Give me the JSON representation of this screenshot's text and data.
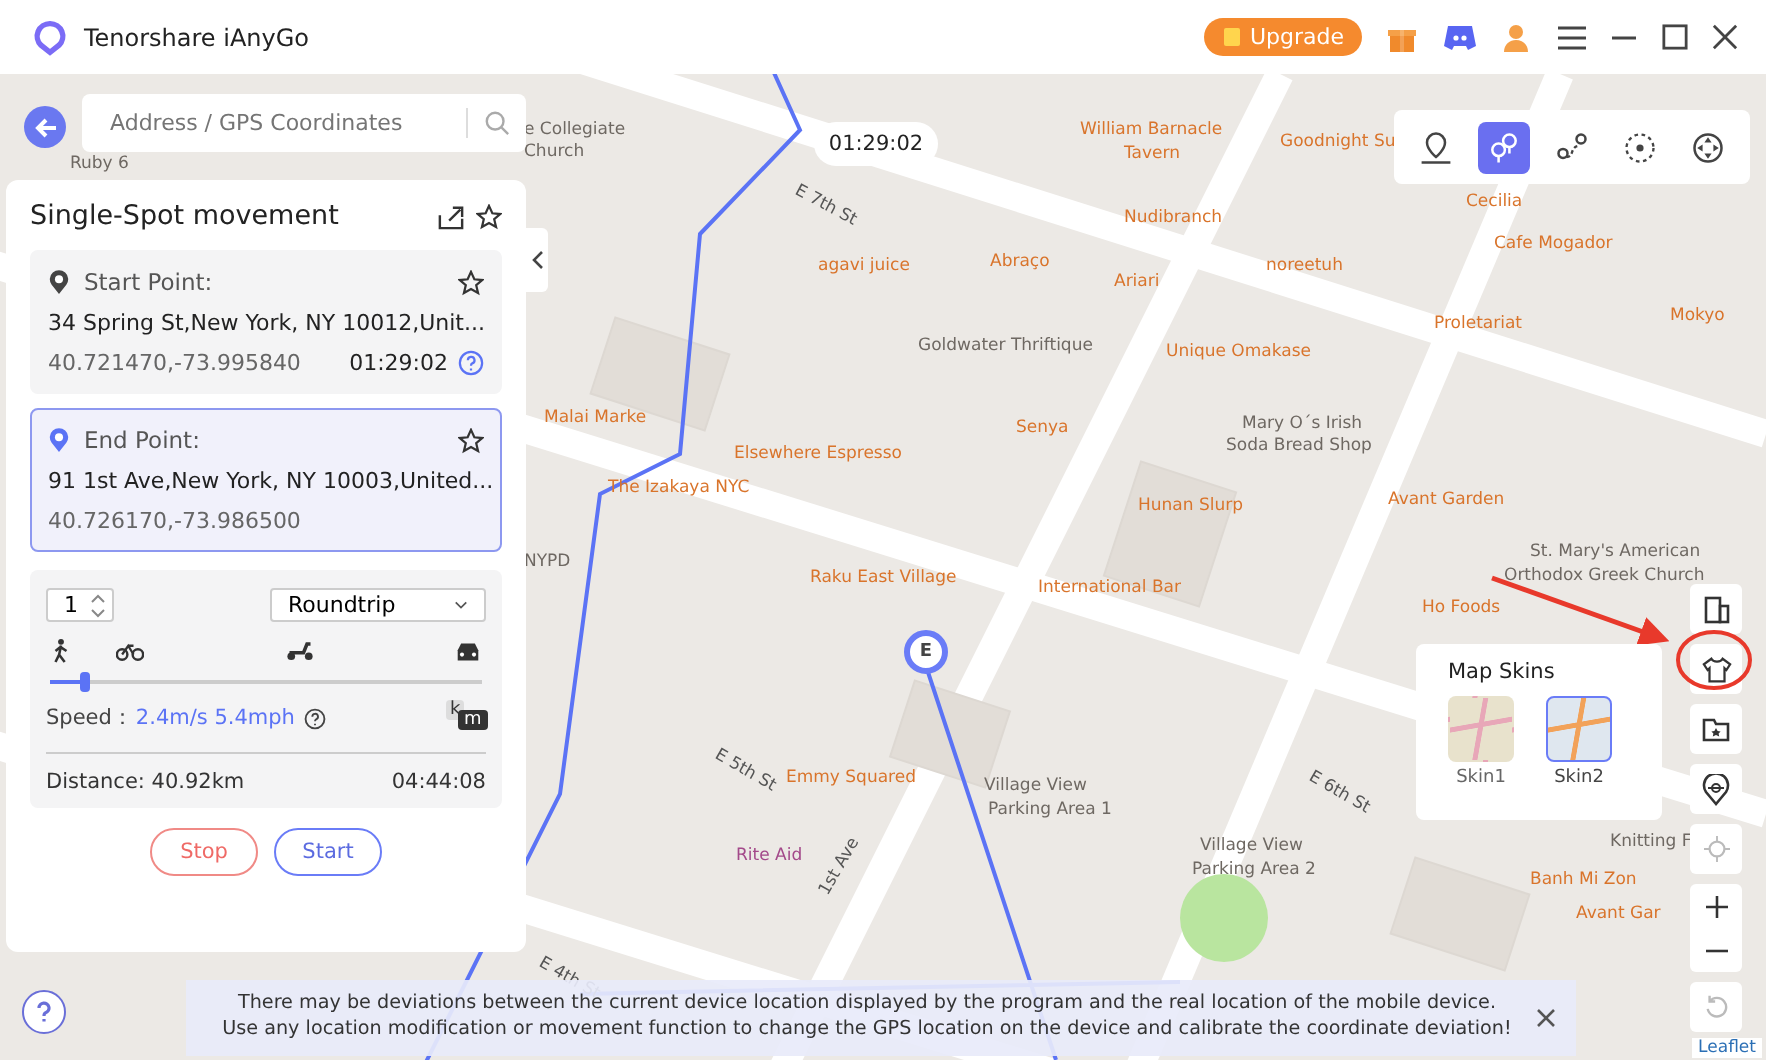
{
  "app": {
    "title": "Tenorshare iAnyGo",
    "upgrade": "Upgrade"
  },
  "search": {
    "placeholder": "Address / GPS Coordinates"
  },
  "timer": "01:29:02",
  "end_marker": "E",
  "modes": [
    {
      "selected": false
    },
    {
      "selected": true
    },
    {
      "selected": false
    },
    {
      "selected": false
    },
    {
      "selected": false
    }
  ],
  "panel": {
    "title": "Single-Spot movement",
    "start": {
      "label": "Start Point:",
      "address": "34 Spring St,New York, NY  10012,Unit...",
      "coords": "40.721470,-73.995840",
      "time": "01:29:02",
      "selected": false
    },
    "end": {
      "label": "End Point:",
      "address": "91 1st Ave,New York, NY  10003,United...",
      "coords": "40.726170,-73.986500",
      "selected": true
    },
    "count": "1",
    "trip": "Roundtrip",
    "speed": {
      "label": "Speed：",
      "value": "2.4m/s 5.4mph",
      "level": 0.08,
      "unit_back": "k",
      "unit_front": "m"
    },
    "distance": "Distance: 40.92km",
    "duration": "04:44:08",
    "stop": "Stop",
    "start_button": "Start"
  },
  "skins": {
    "title": "Map Skins",
    "items": [
      {
        "label": "Skin1",
        "selected": false
      },
      {
        "label": "Skin2",
        "selected": true
      }
    ]
  },
  "notice": "There may be deviations between the current device location displayed by the program and the real location of the mobile device. Use any location modification or movement function to change the GPS location on the device and calibrate the coordinate deviation!",
  "attribution": "Leaflet",
  "map_labels": [
    {
      "text": "e Collegiate",
      "kind": "poi"
    },
    {
      "text": "Church",
      "kind": "poi"
    },
    {
      "text": "E 7th St",
      "kind": "street"
    },
    {
      "text": "William Barnacle",
      "kind": "place"
    },
    {
      "text": "Tavern",
      "kind": "place"
    },
    {
      "text": "Goodnight Su",
      "kind": "place"
    },
    {
      "text": "Cecilia",
      "kind": "place"
    },
    {
      "text": "Nudibranch",
      "kind": "place"
    },
    {
      "text": "Cafe Mogador",
      "kind": "place"
    },
    {
      "text": "agavi juice",
      "kind": "place"
    },
    {
      "text": "Abraço",
      "kind": "place"
    },
    {
      "text": "Ariari",
      "kind": "place"
    },
    {
      "text": "noreetuh",
      "kind": "place"
    },
    {
      "text": "Goldwater Thriftique",
      "kind": "poi"
    },
    {
      "text": "Unique Omakase",
      "kind": "place"
    },
    {
      "text": "Proletariat",
      "kind": "place"
    },
    {
      "text": "Mokyo",
      "kind": "place"
    },
    {
      "text": "Malai Marke",
      "kind": "place"
    },
    {
      "text": "Senya",
      "kind": "place"
    },
    {
      "text": "Mary O´s Irish",
      "kind": "poi"
    },
    {
      "text": "Soda Bread Shop",
      "kind": "poi"
    },
    {
      "text": "Elsewhere Espresso",
      "kind": "place"
    },
    {
      "text": "The Izakaya NYC",
      "kind": "place"
    },
    {
      "text": "Avant Garden",
      "kind": "place"
    },
    {
      "text": "Hunan Slurp",
      "kind": "place"
    },
    {
      "text": "St. Mary's American",
      "kind": "poi"
    },
    {
      "text": "Orthodox Greek Church",
      "kind": "poi"
    },
    {
      "text": "NYPD",
      "kind": "poi"
    },
    {
      "text": "Raku East Village",
      "kind": "place"
    },
    {
      "text": "International Bar",
      "kind": "place"
    },
    {
      "text": "Ho Foods",
      "kind": "place"
    },
    {
      "text": "E 5th St",
      "kind": "street"
    },
    {
      "text": "Emmy Squared",
      "kind": "place"
    },
    {
      "text": "Village View",
      "kind": "poi"
    },
    {
      "text": "Parking Area 1",
      "kind": "poi"
    },
    {
      "text": "E 6th St",
      "kind": "street"
    },
    {
      "text": "Rite Aid",
      "kind": "shop"
    },
    {
      "text": "Village View",
      "kind": "poi"
    },
    {
      "text": "Parking Area 2",
      "kind": "poi"
    },
    {
      "text": "1st Ave",
      "kind": "street"
    },
    {
      "text": "Knitting F",
      "kind": "poi"
    },
    {
      "text": "Banh Mi Zon",
      "kind": "place"
    },
    {
      "text": "Avant Gar",
      "kind": "place"
    },
    {
      "text": "E 4th St",
      "kind": "street"
    },
    {
      "text": "Ruby 6",
      "kind": "poi"
    }
  ]
}
